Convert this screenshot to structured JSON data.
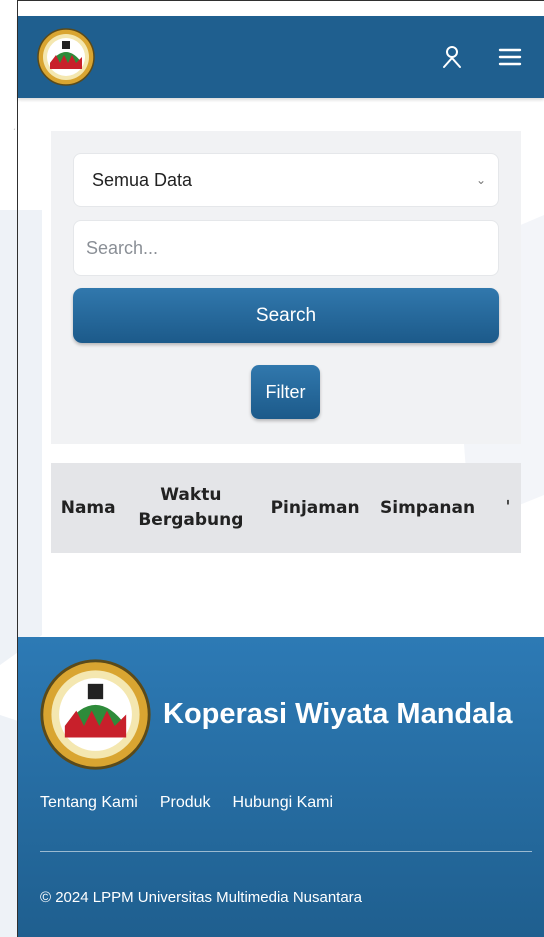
{
  "navbar": {
    "logo_name": "koperasi-logo",
    "user_icon": "user-icon",
    "menu_icon": "hamburger-menu-icon"
  },
  "search_card": {
    "select_value": "Semua Data",
    "search_placeholder": "Search...",
    "search_button_label": "Search",
    "filter_button_label": "Filter"
  },
  "table": {
    "columns": [
      "Nama",
      "Waktu Bergabung",
      "Pinjaman",
      "Simpanan"
    ]
  },
  "footer": {
    "title": "Koperasi Wiyata Mandala",
    "links": [
      "Tentang Kami",
      "Produk",
      "Hubungi Kami"
    ],
    "copyright": "© 2024 LPPM Universitas Multimedia Nusantara"
  },
  "colors": {
    "primary": "#1f5f8f",
    "footer_top": "#2d7ab5",
    "card_bg": "#f1f2f4",
    "table_bg": "#e4e5e8"
  }
}
